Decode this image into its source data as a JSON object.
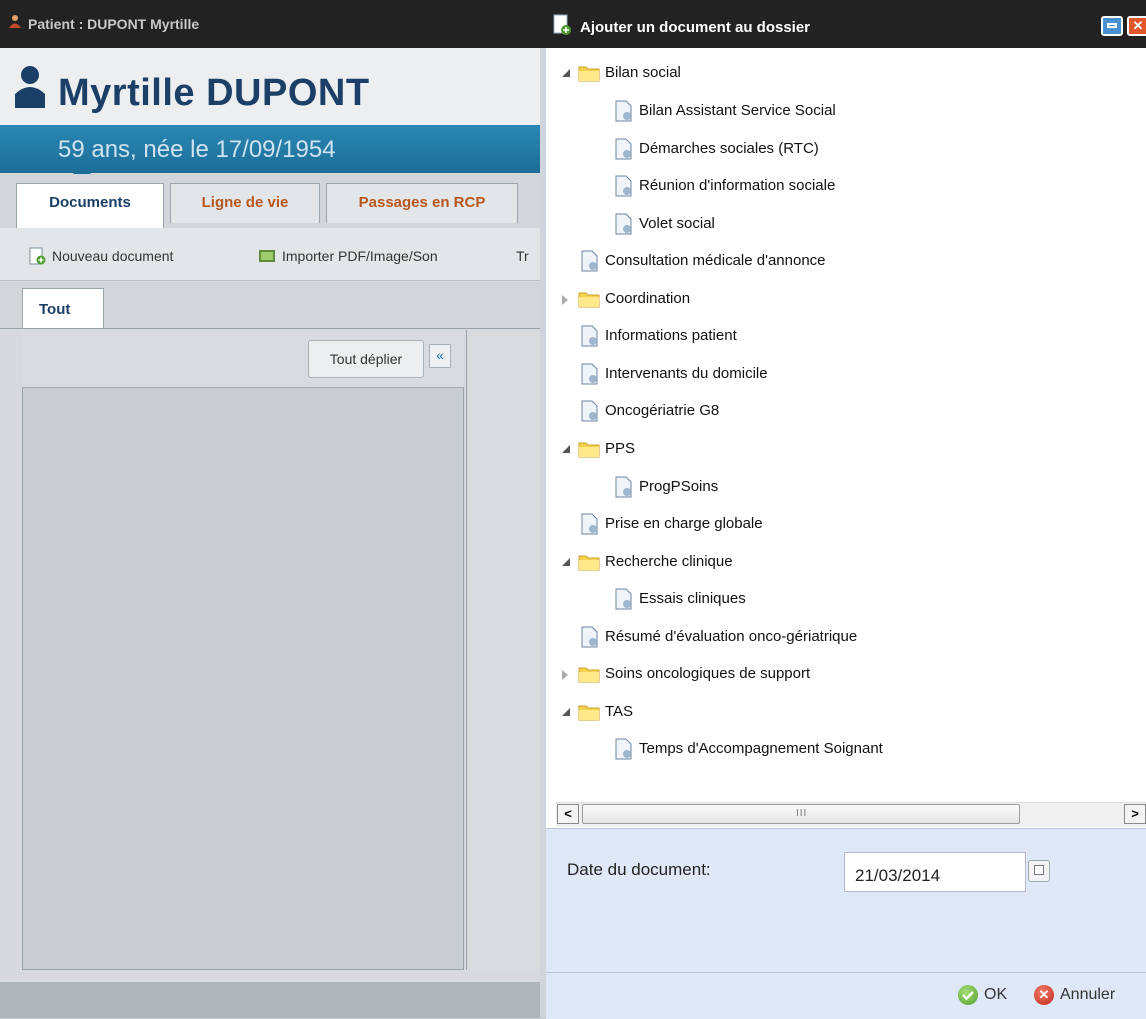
{
  "left_window": {
    "title": "Patient : DUPONT Myrtille",
    "patient_name": "Myrtille DUPONT",
    "age_line": "59 ans, née le 17/09/1954",
    "tabs": [
      {
        "label": "Documents"
      },
      {
        "label": "Ligne de vie"
      },
      {
        "label": "Passages en RCP"
      }
    ],
    "toolbar": {
      "new_document": "Nouveau document",
      "import": "Importer PDF/Image/Son",
      "cut_text": "Tr"
    },
    "subtab": "Tout",
    "expand_all": "Tout déplier",
    "collapse_glyph": "«"
  },
  "dialog": {
    "title": "Ajouter un document au dossier",
    "close_glyph": "✕",
    "tree": [
      {
        "label": "Bilan social"
      },
      {
        "label": "Bilan Assistant Service Social"
      },
      {
        "label": "Démarches sociales (RTC)"
      },
      {
        "label": "Réunion d'information sociale"
      },
      {
        "label": "Volet social"
      },
      {
        "label": "Consultation médicale d'annonce"
      },
      {
        "label": "Coordination"
      },
      {
        "label": "Informations patient"
      },
      {
        "label": "Intervenants du domicile"
      },
      {
        "label": "Oncogériatrie G8"
      },
      {
        "label": "PPS"
      },
      {
        "label": "ProgPSoins"
      },
      {
        "label": "Prise en charge globale"
      },
      {
        "label": "Recherche clinique"
      },
      {
        "label": "Essais cliniques"
      },
      {
        "label": "Résumé d'évaluation onco-gériatrique"
      },
      {
        "label": "Soins oncologiques de support"
      },
      {
        "label": "TAS"
      },
      {
        "label": "Temps d'Accompagnement Soignant"
      }
    ],
    "scroll_left": "<",
    "scroll_right": ">",
    "scroll_grip": "III",
    "date_label": "Date du document:",
    "date_value": "21/03/2014",
    "ok": "OK",
    "cancel": "Annuler",
    "cancel_glyph": "✕"
  },
  "icons": {
    "folder": "folder-icon",
    "document": "document-icon",
    "ok": "check-circle-icon",
    "cancel": "cross-circle-icon"
  },
  "colors": {
    "accent_blue": "#1b3f67",
    "band_blue": "#2a87b4",
    "tab_orange": "#b8561f",
    "dialog_panel": "#dfe8f6"
  }
}
